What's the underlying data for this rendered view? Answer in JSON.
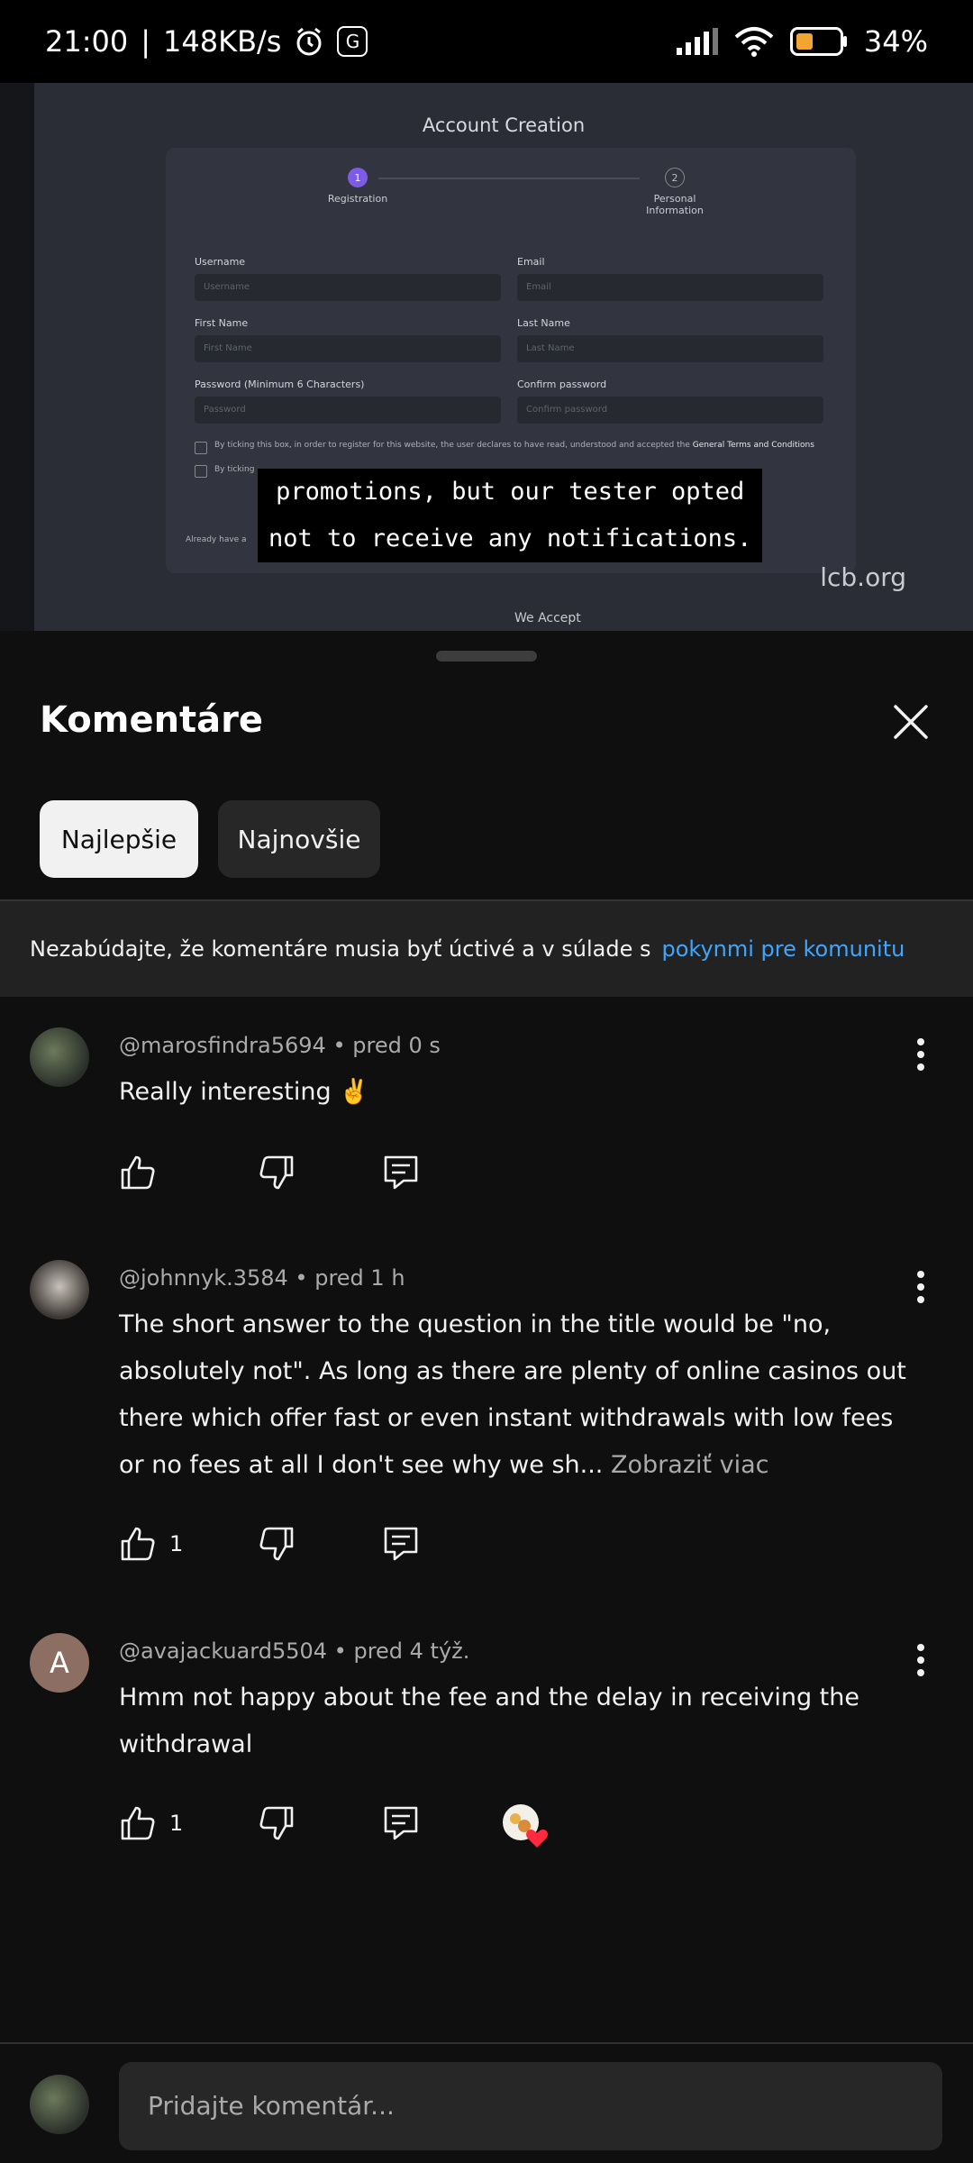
{
  "status_bar": {
    "time": "21:00",
    "separator": "|",
    "network_speed": "148KB/s",
    "battery": "34%",
    "icons": [
      "alarm-icon",
      "g-app-icon",
      "signal-icon",
      "wifi-icon",
      "battery-icon"
    ]
  },
  "video": {
    "title": "Account Creation",
    "steps": [
      {
        "num": "1",
        "label": "Registration"
      },
      {
        "num": "2",
        "label": "Personal Information"
      }
    ],
    "fields": [
      {
        "label": "Username",
        "placeholder": "Username"
      },
      {
        "label": "Email",
        "placeholder": "Email"
      },
      {
        "label": "First Name",
        "placeholder": "First Name"
      },
      {
        "label": "Last Name",
        "placeholder": "Last Name"
      },
      {
        "label": "Password (Minimum 6 Characters)",
        "placeholder": "Password"
      },
      {
        "label": "Confirm password",
        "placeholder": "Confirm password"
      }
    ],
    "terms_text": "By ticking this box, in order to register for this website, the user declares to have read, understood and accepted the",
    "terms_link": "General Terms and Conditions",
    "second_check_text": "By ticking",
    "already_text": "Already have a",
    "caption_line1": "promotions, but our tester opted",
    "caption_line2": "not to receive any notifications.",
    "watermark": "lcb.org",
    "we_accept": "We Accept"
  },
  "sheet": {
    "title": "Komentáre",
    "tabs": [
      {
        "label": "Najlepšie",
        "selected": true
      },
      {
        "label": "Najnovšie",
        "selected": false
      }
    ],
    "notice_text": "Nezabúdajte, že komentáre musia byť úctivé a v súlade s",
    "notice_link": "pokynmi pre komunitu",
    "link_color": "#3ea6ff"
  },
  "comments": [
    {
      "author": "@marosfindra5694",
      "time": "pred 0 s",
      "text": "Really interesting ✌️",
      "likes": "",
      "more": ""
    },
    {
      "author": "@johnnyk.3584",
      "time": "pred 1 h",
      "text": "The short answer to the question in the title would be \"no, absolutely not\". As long as there are plenty of online casinos out there which offer fast or even instant withdrawals with low fees or no fees at all I don't see why we sh...",
      "likes": "1",
      "more": "Zobraziť viac"
    },
    {
      "author": "@avajackuard5504",
      "time": "pred 4 týž.",
      "avatar_letter": "A",
      "text": "Hmm not happy about the fee and the delay in receiving the withdrawal",
      "likes": "1",
      "more": ""
    }
  ],
  "composer": {
    "placeholder": "Pridajte komentár..."
  }
}
